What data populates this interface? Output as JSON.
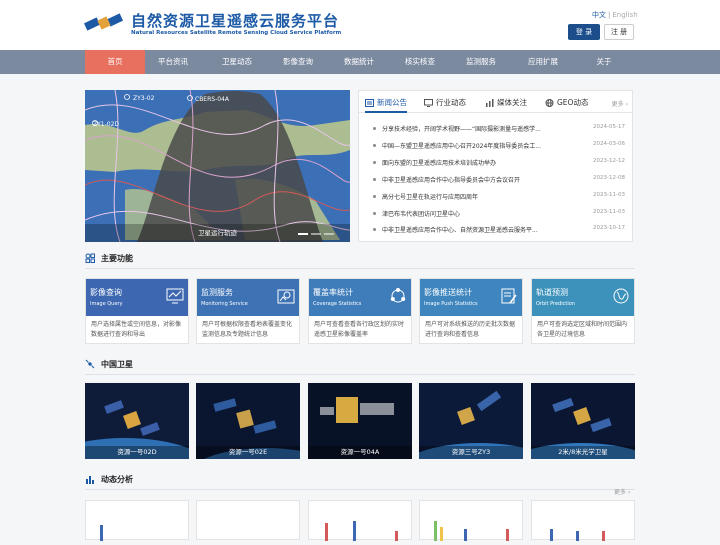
{
  "header": {
    "title_cn": "自然资源卫星遥感云服务平台",
    "title_en": "Natural Resources Satellite Remote Sensing Cloud Service Platform",
    "lang_cn": "中文",
    "lang_sep": "|",
    "lang_en": "English",
    "login": "登 录",
    "register": "注 册"
  },
  "nav": [
    "首页",
    "平台资讯",
    "卫星动态",
    "影像查询",
    "数据统计",
    "核实核查",
    "监测服务",
    "应用扩展",
    "关于"
  ],
  "carousel": {
    "caption": "卫星运行轨迹",
    "labels": [
      "ZY3-02",
      "CBERS-04A",
      "ZY1-02D"
    ]
  },
  "news": {
    "tabs": [
      "新闻公告",
      "行业动态",
      "媒体关注",
      "GEO动态"
    ],
    "more": "更多",
    "items": [
      {
        "title": "分享技术经验，开阔学术视野——“国际摄影测量与遥感学...",
        "date": "2024-05-17"
      },
      {
        "title": "中国—东盟卫星遥感应用中心召开2024年度指导委员会工...",
        "date": "2024-03-06"
      },
      {
        "title": "面向东盟的卫星遥感应用技术培训成功举办",
        "date": "2023-12-12"
      },
      {
        "title": "中非卫星遥感应用合作中心指导委员会中方会议召开",
        "date": "2023-12-08"
      },
      {
        "title": "高分七号卫星在轨运行与应用四周年",
        "date": "2023-11-03"
      },
      {
        "title": "津巴布韦代表团访问卫星中心",
        "date": "2023-11-03"
      },
      {
        "title": "中非卫星遥感应用合作中心、自然资源卫星遥感云服务平...",
        "date": "2023-10-17"
      }
    ]
  },
  "sections": {
    "features": "主要功能",
    "satellites": "中国卫星",
    "analysis": "动态分析",
    "more": "更多"
  },
  "features": [
    {
      "cn": "影像查询",
      "en": "Image Query",
      "desc": "用户选择属性或空间信息，对影像数据进行查询和导出",
      "color": "#3d67b1",
      "icon": "monitor-chart-icon"
    },
    {
      "cn": "监测服务",
      "en": "Monitoring Service",
      "desc": "用户可根据权限查看地表覆盖变化监测信息及专题统计信息",
      "color": "#3d72b5",
      "icon": "map-pin-icon"
    },
    {
      "cn": "覆盖率统计",
      "en": "Coverage Statistics",
      "desc": "用户可查看查看各行政区划的实时遥感卫星影像覆盖率",
      "color": "#3f7cba",
      "icon": "share-nodes-icon"
    },
    {
      "cn": "影像推送统计",
      "en": "Image Push Statistics",
      "desc": "用户可对系统推送的历史批次数据进行查询和查看信息",
      "color": "#3f86bf",
      "icon": "document-edit-icon"
    },
    {
      "cn": "轨道预测",
      "en": "Orbit Prediction",
      "desc": "用户可查询选定区域和时间范围内各卫星的过境信息",
      "color": "#3d92bc",
      "icon": "globe-icon"
    }
  ],
  "satellites": [
    "资源一号02D",
    "资源一号02E",
    "资源一号04A",
    "资源三号ZY3",
    "2米/8米光学卫星"
  ],
  "colors": {
    "accent": "#1c5aa6",
    "nav_bg": "#7c8aa0",
    "nav_active": "#e8705f"
  }
}
